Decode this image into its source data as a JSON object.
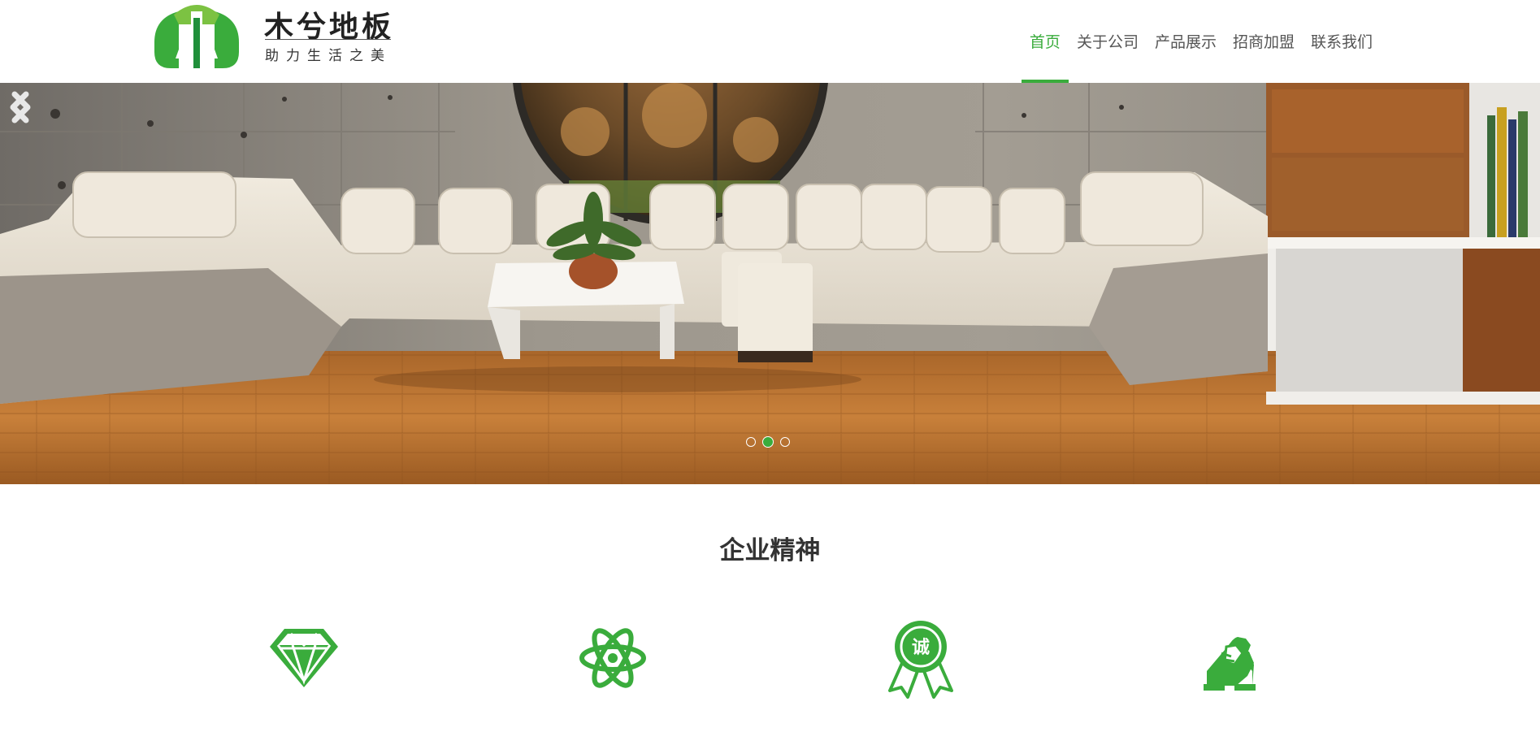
{
  "header": {
    "logo_name": "木兮地板",
    "logo_slogan": "助力生活之美"
  },
  "nav": {
    "items": [
      {
        "label": "首页",
        "active": true
      },
      {
        "label": "关于公司",
        "active": false
      },
      {
        "label": "产品展示",
        "active": false
      },
      {
        "label": "招商加盟",
        "active": false
      },
      {
        "label": "联系我们",
        "active": false
      }
    ]
  },
  "banner": {
    "slide_count": 3,
    "active_slide": 2
  },
  "section": {
    "title": "企业精神",
    "icons": [
      "diamond-icon",
      "atom-icon",
      "integrity-badge-icon",
      "handshake-icon"
    ],
    "badge_text": "诚"
  },
  "colors": {
    "accent": "#3aac3c",
    "nav_text": "#555555",
    "title_text": "#333333"
  }
}
